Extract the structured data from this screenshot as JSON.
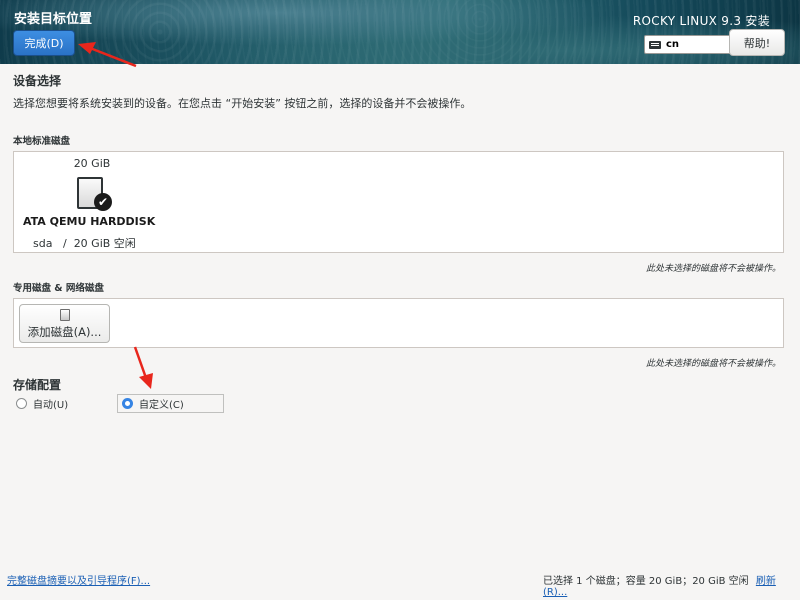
{
  "header": {
    "page_title": "安装目标位置",
    "done_label": "完成(D)",
    "product_title": "ROCKY LINUX 9.3 安装",
    "keyboard_layout": "cn",
    "help_label": "帮助!"
  },
  "device_selection": {
    "title": "设备选择",
    "description": "选择您想要将系统安装到的设备。在您点击 “开始安装” 按钮之前，选择的设备并不会被操作。"
  },
  "local_disks": {
    "title": "本地标准磁盘",
    "disks": [
      {
        "size": "20 GiB",
        "name": "ATA QEMU HARDDISK",
        "device": "sda",
        "separator": "/",
        "free": "20 GiB 空闲",
        "selected": true
      }
    ],
    "note": "此处未选择的磁盘将不会被操作。"
  },
  "specialized_disks": {
    "title": "专用磁盘 & 网络磁盘",
    "add_disk_label": "添加磁盘(A)...",
    "note": "此处未选择的磁盘将不会被操作。"
  },
  "storage_config": {
    "title": "存储配置",
    "options": [
      {
        "label": "自动(U)",
        "checked": false
      },
      {
        "label": "自定义(C)",
        "checked": true
      }
    ]
  },
  "footer": {
    "summary_link": "完整磁盘摘要以及引导程序(F)...",
    "status": "已选择 1 个磁盘；容量 20 GiB；20 GiB 空闲",
    "refresh_link": "刷新(R)..."
  },
  "colors": {
    "accent": "#3584e4",
    "link": "#1a5fb4",
    "annotation": "#e8261c"
  }
}
